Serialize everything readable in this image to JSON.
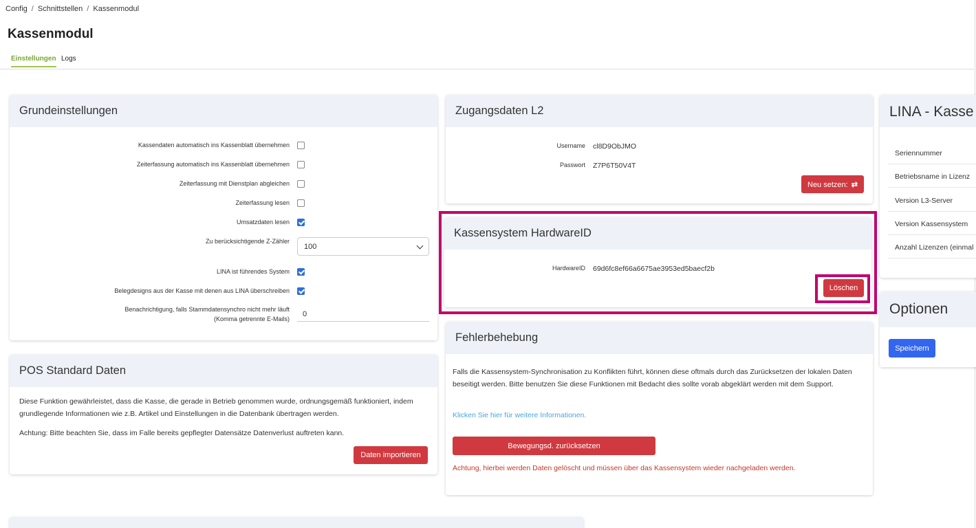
{
  "breadcrumb": [
    "Config",
    "Schnittstellen",
    "Kassenmodul"
  ],
  "breadcrumb_sep": "/",
  "page_title": "Kassenmodul",
  "tabs": [
    {
      "label": "Einstellungen",
      "active": true
    },
    {
      "label": "Logs",
      "active": false
    }
  ],
  "grundeinstellungen": {
    "title": "Grundeinstellungen",
    "rows": [
      {
        "label": "Kassendaten automatisch ins Kassenblatt übernehmen",
        "checked": false
      },
      {
        "label": "Zeiterfassung automatisch ins Kassenblatt übernehmen",
        "checked": false
      },
      {
        "label": "Zeiterfassung mit Dienstplan abgleichen",
        "checked": false
      },
      {
        "label": "Zeiterfassung lesen",
        "checked": false
      },
      {
        "label": "Umsatzdaten lesen",
        "checked": true
      }
    ],
    "z_zaehler_label": "Zu berücksichtigende Z-Zähler",
    "z_zaehler_value": "100",
    "rows2": [
      {
        "label": "LINA ist führendes System",
        "checked": true
      },
      {
        "label": "Belegdesigns aus der Kasse mit denen aus LINA überschreiben",
        "checked": true
      }
    ],
    "benachrichtigung_label_1": "Benachrichtigung, falls Stammdatensynchro nicht mehr läuft",
    "benachrichtigung_label_2": "(Komma getrennte E-Mails)",
    "benachrichtigung_value": "0"
  },
  "pos": {
    "title": "POS Standard Daten",
    "text1": "Diese Funktion gewährleistet, dass die Kasse, die gerade in Betrieb genommen wurde, ordnungsgemäß funktioniert, indem grundlegende Informationen wie z.B. Artikel und Einstellungen in die Datenbank übertragen werden.",
    "text2": "Achtung: Bitte beachten Sie, dass im Falle bereits gepflegter Datensätze Datenverlust auftreten kann.",
    "button": "Daten importieren"
  },
  "zugang": {
    "title": "Zugangsdaten L2",
    "username_label": "Username",
    "username_value": "cl8D9ObJMO",
    "password_label": "Passwort",
    "password_value": "Z7P6T50V4T",
    "button": "Neu setzen:"
  },
  "hardware": {
    "title": "Kassensystem HardwareID",
    "label": "HardwareID",
    "value": "69d6fc8ef66a6675ae3953ed5baecf2b",
    "button": "Löschen"
  },
  "fehler": {
    "title": "Fehlerbehebung",
    "text": "Falls die Kassensystem-Synchronisation zu Konflikten führt, können diese oftmals durch das Zurücksetzen der lokalen Daten beseitigt werden. Bitte benutzen Sie diese Funktionen mit Bedacht dies sollte vorab abgeklärt werden mit dem Support.",
    "link": "Klicken Sie hier für weitere Informationen.",
    "button": "Bewegungsd. zurücksetzen",
    "warning": "Achtung, hierbei werden Daten gelöscht und müssen über das Kassensystem wieder nachgeladen werden."
  },
  "lina": {
    "title": "LINA - Kasse",
    "rows": [
      "Seriennummer",
      "Betriebsname in Lizenz",
      "Version L3-Server",
      "Version Kassensystem",
      "Anzahl Lizenzen (einmal"
    ]
  },
  "optionen": {
    "title": "Optionen",
    "button": "Speichern"
  },
  "colors": {
    "accent_green": "#7aa632",
    "danger_red": "#d0393f",
    "primary_blue": "#3366ee",
    "highlight_magenta": "#c2006e",
    "checkbox_blue": "#2f6fd8"
  }
}
